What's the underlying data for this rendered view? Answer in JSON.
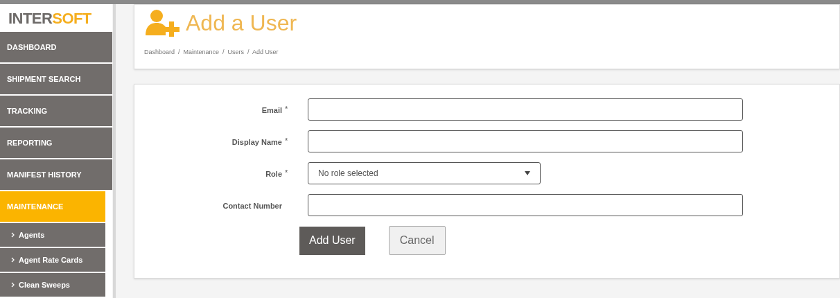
{
  "logo": {
    "dark": "INTER",
    "accent": "SOFT"
  },
  "sidebar": {
    "items": [
      {
        "label": "DASHBOARD",
        "selected": false
      },
      {
        "label": "SHIPMENT SEARCH",
        "selected": false
      },
      {
        "label": "TRACKING",
        "selected": false
      },
      {
        "label": "REPORTING",
        "selected": false
      },
      {
        "label": "MANIFEST HISTORY",
        "selected": false
      },
      {
        "label": "MAINTENANCE",
        "selected": true,
        "children": [
          {
            "label": "Agents"
          },
          {
            "label": "Agent Rate Cards"
          },
          {
            "label": "Clean Sweeps"
          }
        ]
      }
    ]
  },
  "page_title": "Add a User",
  "breadcrumb": "Dashboard  /  Maintenance  /  Users  /  Add User",
  "form": {
    "required_mark": "*",
    "fields": [
      {
        "label": "Email",
        "required": true,
        "kind": "input"
      },
      {
        "label": "Display Name",
        "required": true,
        "kind": "input"
      },
      {
        "label": "Role",
        "required": true,
        "kind": "select",
        "value": "No role selected"
      },
      {
        "label": "Contact Number",
        "required": false,
        "kind": "input"
      }
    ],
    "buttons": [
      {
        "label": "Add User",
        "kind": "primary"
      },
      {
        "label": "Cancel",
        "kind": "secondary"
      }
    ]
  }
}
